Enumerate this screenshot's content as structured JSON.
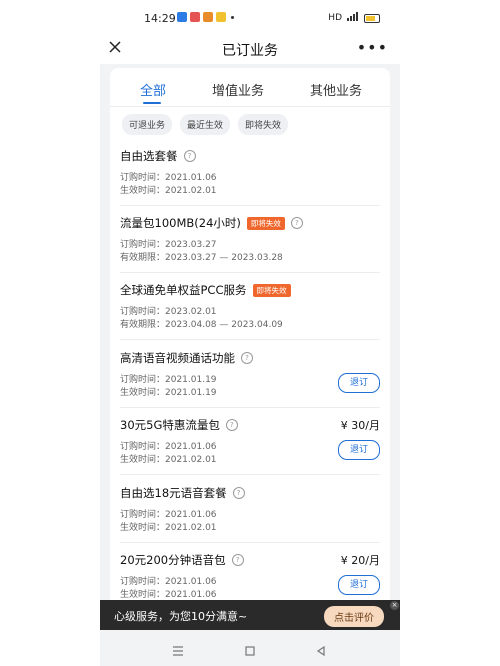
{
  "status": {
    "time": "14:29",
    "network": "HD",
    "signal": "4G"
  },
  "header": {
    "title": "已订业务"
  },
  "tabs": [
    "全部",
    "增值业务",
    "其他业务"
  ],
  "chips": [
    "可退业务",
    "最近生效",
    "即将失效"
  ],
  "items": [
    {
      "title": "自由选套餐",
      "line1": "订购时间：2021.01.06",
      "line2": "生效时间：2021.02.01"
    },
    {
      "title": "流量包100MB(24小时)",
      "badge": "即将失效",
      "line1": "订购时间：2023.03.27",
      "line2": "有效期限：2023.03.27 — 2023.03.28"
    },
    {
      "title": "全球通免单权益PCC服务",
      "badge": "即将失效",
      "line1": "订购时间：2023.02.01",
      "line2": "有效期限：2023.04.08 — 2023.04.09"
    },
    {
      "title": "高清语音视频通话功能",
      "line1": "订购时间：2021.01.19",
      "line2": "生效时间：2021.01.19",
      "button": "退订"
    },
    {
      "title": "30元5G特惠流量包",
      "price": "¥ 30/月",
      "line1": "订购时间：2021.01.06",
      "line2": "生效时间：2021.02.01",
      "button": "退订"
    },
    {
      "title": "自由选18元语音套餐",
      "line1": "订购时间：2021.01.06",
      "line2": "生效时间：2021.02.01"
    },
    {
      "title": "20元200分钟语音包",
      "price": "¥ 20/月",
      "line1": "订购时间：2021.01.06",
      "line2": "生效时间：2021.01.06",
      "button": "退订"
    }
  ],
  "feedback": {
    "text": "心级服务，为您10分满意~",
    "button": "点击评价"
  },
  "colors": {
    "accent": "#1f6fd6",
    "badge": "#f0672d",
    "feedback_bg": "#2a2a2a"
  }
}
